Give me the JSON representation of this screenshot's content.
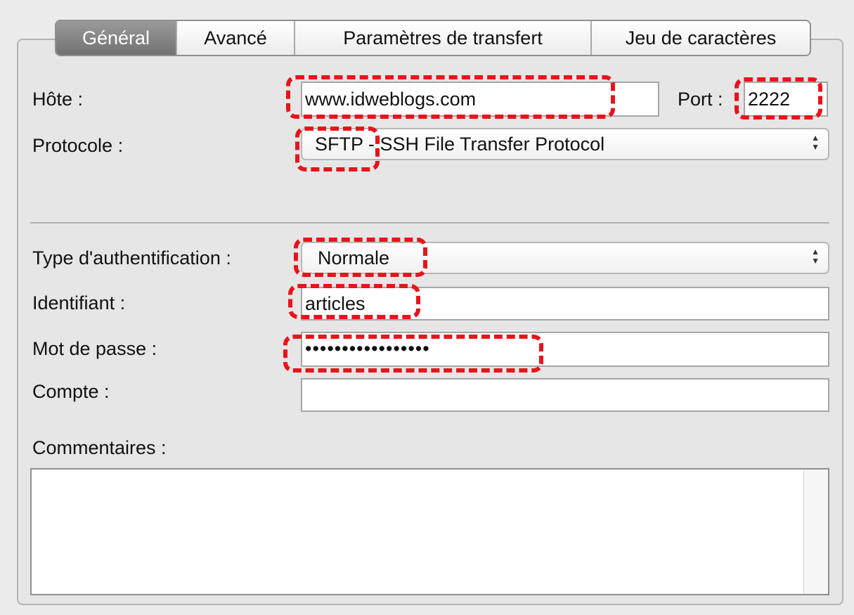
{
  "tabs": [
    {
      "label": "Général",
      "active": true
    },
    {
      "label": "Avancé",
      "active": false
    },
    {
      "label": "Paramètres de transfert",
      "active": false
    },
    {
      "label": "Jeu de caractères",
      "active": false
    }
  ],
  "host": {
    "label": "Hôte :",
    "value": "www.idweblogs.com"
  },
  "port": {
    "label": "Port :",
    "value": "2222"
  },
  "protocol": {
    "label": "Protocole :",
    "value": "SFTP - SSH File Transfer Protocol"
  },
  "auth_type": {
    "label": "Type d'authentification :",
    "value": "Normale"
  },
  "username": {
    "label": "Identifiant :",
    "value": "articles"
  },
  "password": {
    "label": "Mot de passe :",
    "value": "•••••••••••••••••"
  },
  "account": {
    "label": "Compte :",
    "value": ""
  },
  "comments": {
    "label": "Commentaires :",
    "value": ""
  },
  "colors": {
    "highlight": "#e8141b",
    "active_tab": "#7f7f7f",
    "background": "#ececec"
  }
}
